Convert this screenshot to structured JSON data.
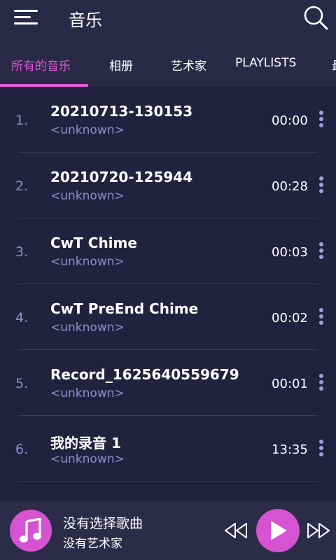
{
  "header": {
    "title": "音乐",
    "menu_icon": "hamburger-menu-icon",
    "search_icon": "search-icon"
  },
  "tabs": [
    {
      "label": "所有的音乐",
      "active": true
    },
    {
      "label": "相册",
      "active": false
    },
    {
      "label": "艺术家",
      "active": false
    },
    {
      "label": "PLAYLISTS",
      "active": false
    },
    {
      "label": "最",
      "active": false
    }
  ],
  "songs": [
    {
      "index": "1.",
      "title": "20210713-130153",
      "artist": "<unknown>",
      "duration": "00:00"
    },
    {
      "index": "2.",
      "title": "20210720-125944",
      "artist": "<unknown>",
      "duration": "00:28"
    },
    {
      "index": "3.",
      "title": "CwT Chime",
      "artist": "<unknown>",
      "duration": "00:03"
    },
    {
      "index": "4.",
      "title": "CwT PreEnd Chime",
      "artist": "<unknown>",
      "duration": "00:02"
    },
    {
      "index": "5.",
      "title": "Record_1625640559679",
      "artist": "<unknown>",
      "duration": "00:01"
    },
    {
      "index": "6.",
      "title": "我的录音 1",
      "artist": "<unknown>",
      "duration": "13:35"
    }
  ],
  "player": {
    "song_title": "没有选择歌曲",
    "artist": "没有艺术家",
    "icons": [
      "music-note-icon",
      "rewind-icon",
      "play-icon",
      "fast-forward-icon"
    ]
  },
  "colors": {
    "accent": "#e05bd8",
    "background": "#23223e",
    "secondary_text": "#8e8ccc"
  }
}
